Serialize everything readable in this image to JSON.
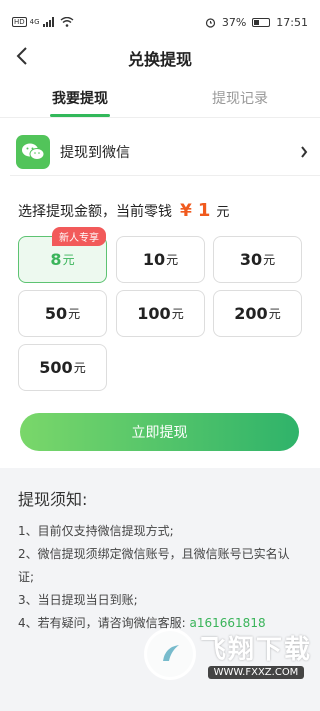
{
  "status_bar": {
    "hd": "HD",
    "signal": "4G",
    "battery_level": 0.37,
    "battery_pct": "37%",
    "time": "17:51"
  },
  "header": {
    "title": "兑换提现"
  },
  "tabs": [
    {
      "label": "我要提现",
      "active": true
    },
    {
      "label": "提现记录",
      "active": false
    }
  ],
  "wechat": {
    "label": "提现到微信",
    "icon": "wechat-icon"
  },
  "amount": {
    "prompt": "选择提现金额，当前零钱",
    "currency_symbol": "¥",
    "balance": "1",
    "unit": "元"
  },
  "options": [
    {
      "value": "8",
      "unit": "元",
      "selected": true,
      "badge": "新人专享"
    },
    {
      "value": "10",
      "unit": "元"
    },
    {
      "value": "30",
      "unit": "元"
    },
    {
      "value": "50",
      "unit": "元"
    },
    {
      "value": "100",
      "unit": "元"
    },
    {
      "value": "200",
      "unit": "元"
    },
    {
      "value": "500",
      "unit": "元"
    }
  ],
  "withdraw_button": "立即提现",
  "notice": {
    "title": "提现须知:",
    "items": [
      "1、目前仅支持微信提现方式;",
      "2、微信提现须绑定微信账号，且微信账号已实名认证;",
      "3、当日提现当日到账;"
    ],
    "contact_prefix": "4、若有疑问，请咨询微信客服:",
    "contact_id": "a161661818"
  },
  "watermark": {
    "big": "飞翔下载",
    "small": "WWW.FXXZ.COM"
  },
  "colors": {
    "accent": "#32b85a",
    "orange": "#f05a1e",
    "badge": "#f25a5a"
  }
}
